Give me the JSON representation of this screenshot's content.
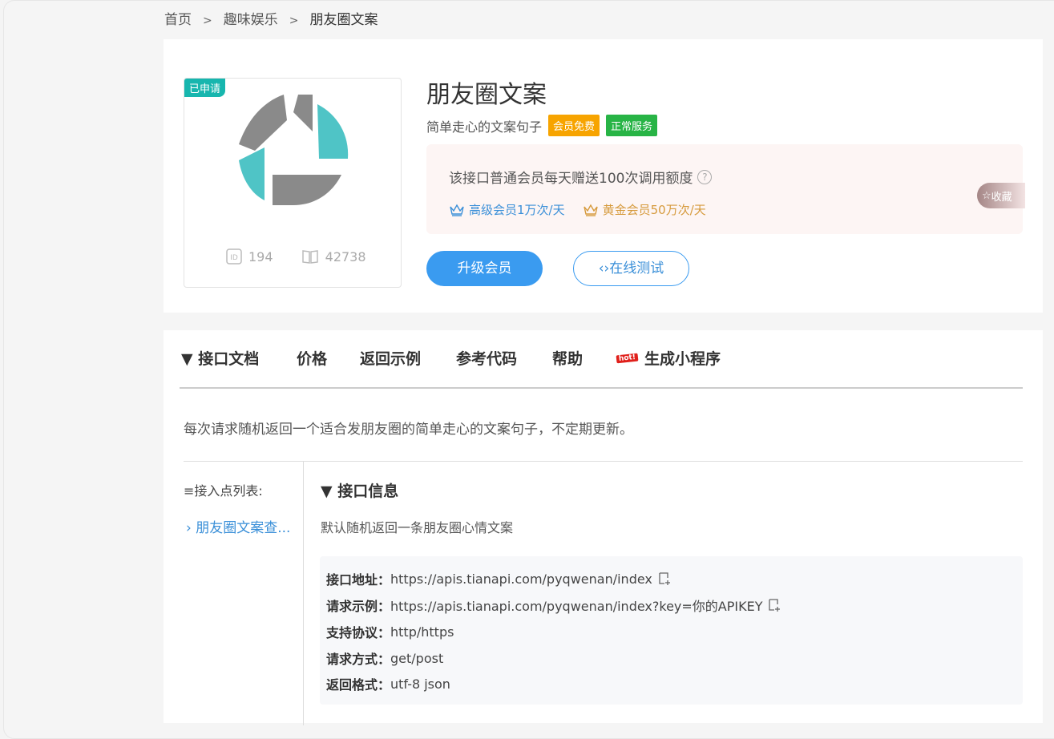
{
  "breadcrumb": {
    "home": "首页",
    "sep1": ">",
    "category": "趣味娱乐",
    "sep2": ">",
    "current": "朋友圈文案"
  },
  "api": {
    "applied_badge": "已申请",
    "id": "194",
    "views": "42738",
    "title": "朋友圈文案",
    "subtitle": "简单走心的文案句子",
    "tag_member_free": "会员免费",
    "tag_status": "正常服务",
    "quota_text": "该接口普通会员每天赠送100次调用额度",
    "quota_help": "?",
    "tier_senior": "高级会员1万次/天",
    "tier_gold": "黄金会员50万次/天",
    "favorite": "收藏",
    "upgrade_button": "升级会员",
    "test_button": "在线测试"
  },
  "colors": {
    "accent_blue": "#3a9bf0",
    "tag_orange": "#f7a400",
    "tag_green": "#28b446",
    "teal": "#17b6ae",
    "logo_teal": "#4fc4c6",
    "logo_gray": "#8a8a8a"
  },
  "tabs": [
    {
      "label": "▼ 接口文档"
    },
    {
      "label": "价格"
    },
    {
      "label": "返回示例"
    },
    {
      "label": "参考代码"
    },
    {
      "label": "帮助"
    },
    {
      "label": "生成小程序",
      "badge": "hot!"
    }
  ],
  "description": "每次请求随机返回一个适合发朋友圈的简单走心的文案句子，不定期更新。",
  "sidebar": {
    "title": "≡接入点列表:",
    "item": "朋友圈文案查..."
  },
  "info": {
    "title": "▼ 接口信息",
    "desc": "默认随机返回一条朋友圈心情文案",
    "rows": [
      {
        "label": "接口地址：",
        "value": "https://apis.tianapi.com/pyqwenan/index"
      },
      {
        "label": "请求示例：",
        "value": "https://apis.tianapi.com/pyqwenan/index?key=你的APIKEY"
      },
      {
        "label": "支持协议：",
        "value": "http/https"
      },
      {
        "label": "请求方式：",
        "value": "get/post"
      },
      {
        "label": "返回格式：",
        "value": "utf-8 json"
      }
    ]
  }
}
